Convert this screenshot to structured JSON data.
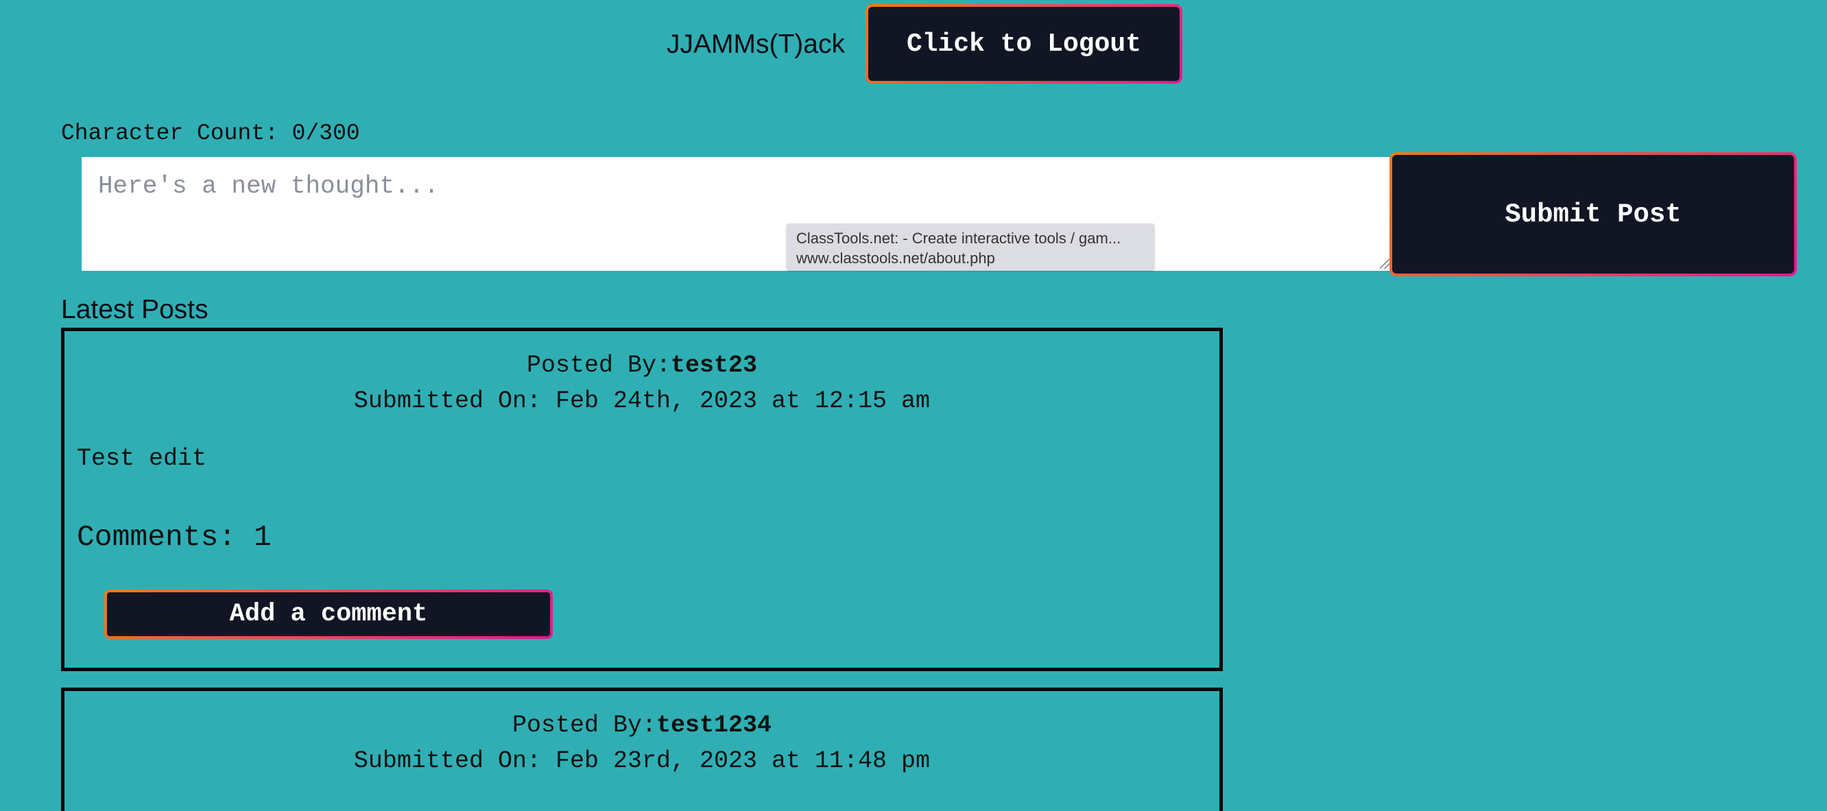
{
  "header": {
    "site_title": "JJAMMs(T)ack",
    "logout_label": "Click to Logout"
  },
  "composer": {
    "char_count_label": "Character Count: 0/300",
    "placeholder": "Here's a new thought...",
    "submit_label": "Submit Post"
  },
  "tooltip": {
    "title": "ClassTools.net: - Create interactive tools / gam...",
    "url": "www.classtools.net/about.php"
  },
  "feed": {
    "heading": "Latest Posts",
    "posts": [
      {
        "posted_by_label": "Posted By:",
        "username": "test23",
        "submitted_on": "Submitted On: Feb 24th, 2023 at 12:15 am",
        "body": "Test edit",
        "comments_label": "Comments: 1",
        "add_comment_label": "Add a comment"
      },
      {
        "posted_by_label": "Posted By:",
        "username": "test1234",
        "submitted_on": "Submitted On: Feb 23rd, 2023 at 11:48 pm"
      }
    ]
  },
  "colors": {
    "background": "#2fafb4",
    "button_bg": "#121624",
    "button_border_gradient_start": "#f57b15",
    "button_border_gradient_end": "#e8168f"
  }
}
